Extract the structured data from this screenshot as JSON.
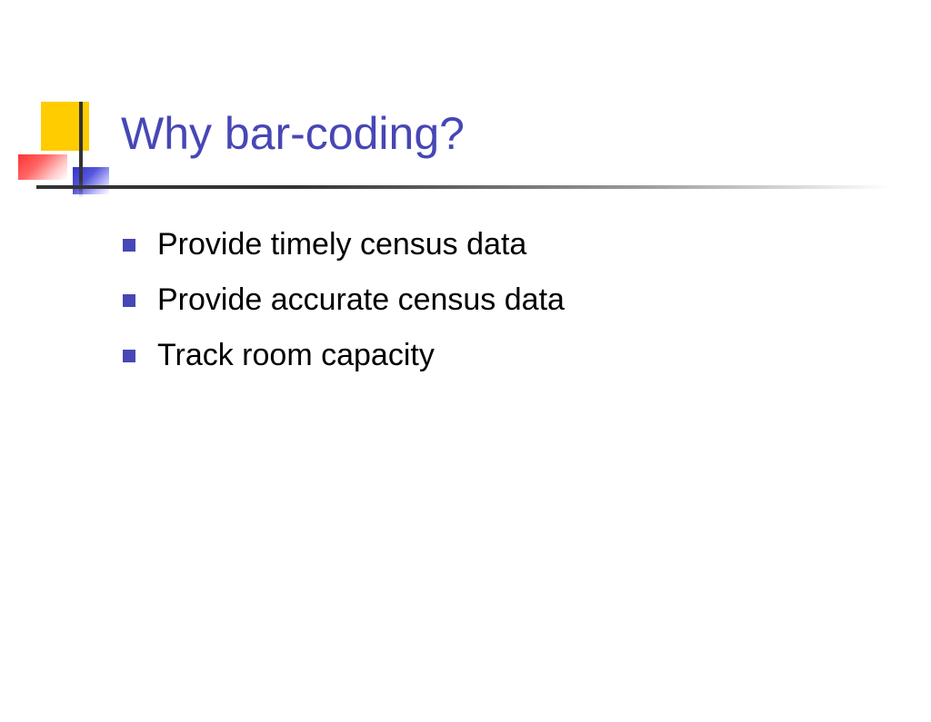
{
  "slide": {
    "title": "Why bar-coding?",
    "bullets": [
      "Provide timely census data",
      "Provide accurate census data",
      "Track room capacity"
    ]
  }
}
